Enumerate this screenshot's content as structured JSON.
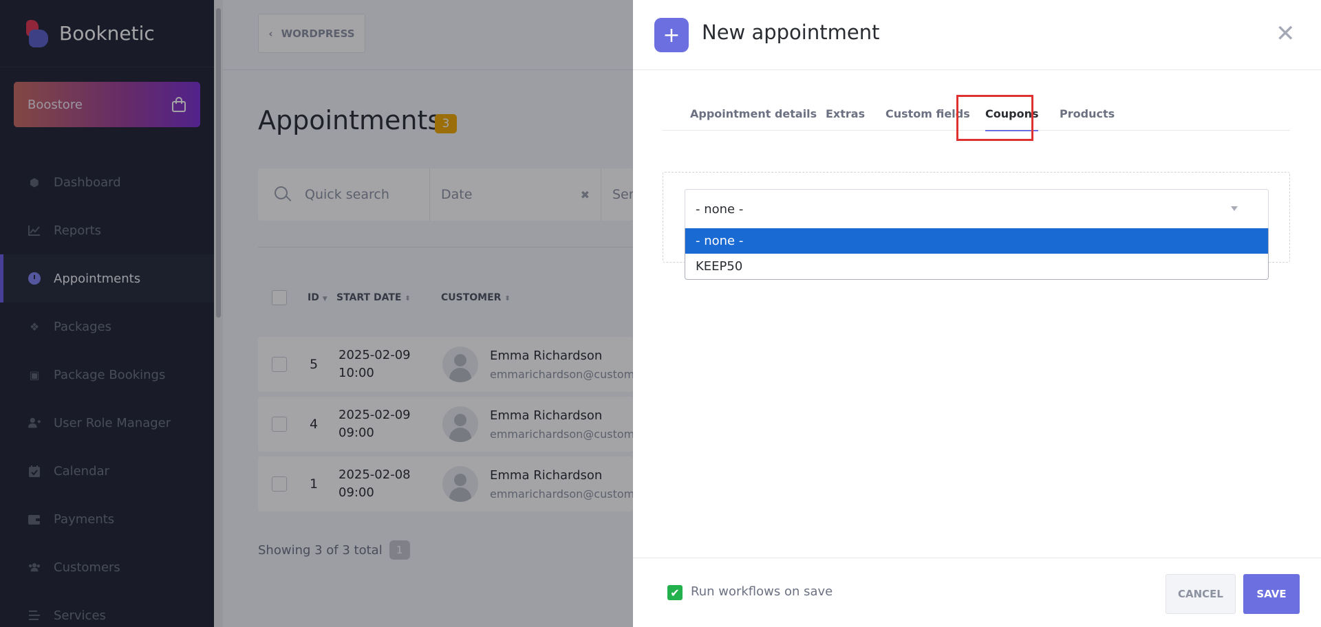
{
  "sidebar": {
    "brand": "Booknetic",
    "boostore": "Boostore",
    "items": [
      {
        "label": "Dashboard",
        "icon": "cube-icon"
      },
      {
        "label": "Reports",
        "icon": "chart-icon"
      },
      {
        "label": "Appointments",
        "icon": "clock-icon",
        "active": true
      },
      {
        "label": "Packages",
        "icon": "boxes-icon"
      },
      {
        "label": "Package Bookings",
        "icon": "gift-icon"
      },
      {
        "label": "User Role Manager",
        "icon": "user-plus-icon"
      },
      {
        "label": "Calendar",
        "icon": "calendar-icon"
      },
      {
        "label": "Payments",
        "icon": "wallet-icon"
      },
      {
        "label": "Customers",
        "icon": "users-icon"
      },
      {
        "label": "Services",
        "icon": "list-icon"
      }
    ]
  },
  "main": {
    "wordpress_button": "WORDPRESS",
    "title": "Appointments",
    "count": "3",
    "search_placeholder": "Quick search",
    "date_placeholder": "Date",
    "service_placeholder": "Ser",
    "columns": {
      "id": "ID",
      "start_date": "START DATE",
      "customer": "CUSTOMER"
    },
    "rows": [
      {
        "id": "5",
        "date": "2025-02-09",
        "time": "10:00",
        "name": "Emma Richardson",
        "email": "emmarichardson@customer.com"
      },
      {
        "id": "4",
        "date": "2025-02-09",
        "time": "09:00",
        "name": "Emma Richardson",
        "email": "emmarichardson@customer.com"
      },
      {
        "id": "1",
        "date": "2025-02-08",
        "time": "09:00",
        "name": "Emma Richardson",
        "email": "emmarichardson@customer.com"
      }
    ],
    "showing": "Showing 3 of 3 total",
    "page": "1"
  },
  "modal": {
    "title": "New appointment",
    "tabs": [
      "Appointment details",
      "Extras",
      "Custom fields",
      "Coupons",
      "Products"
    ],
    "active_tab": "Coupons",
    "coupon_select": {
      "value": "- none -",
      "options": [
        "- none -",
        "KEEP50"
      ],
      "highlighted": "- none -"
    },
    "run_workflows_label": "Run workflows on save",
    "run_workflows_checked": true,
    "cancel": "CANCEL",
    "save": "SAVE"
  },
  "colors": {
    "accent": "#6c6fe0",
    "sidebar_bg": "#1f2433",
    "highlight_red": "#e03131",
    "option_selected": "#1a6ad3",
    "badge": "#f0a800",
    "check_green": "#22b14c"
  }
}
